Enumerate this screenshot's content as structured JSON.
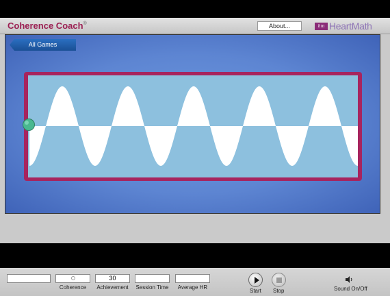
{
  "header": {
    "title": "Coherence Coach",
    "title_mark": "®",
    "about_label": "About...",
    "logo_text": "HeartMath",
    "logo_mark": "hm"
  },
  "game": {
    "all_games_label": "All Games",
    "wave_cycles": 5,
    "colors": {
      "frame": "#a7245e",
      "field": "#8dc0de",
      "wave": "#ffffff",
      "ball": "#49b88f"
    }
  },
  "controls": {
    "field1_value": "",
    "coherence_label": "Coherence",
    "achievement_value": "30",
    "achievement_label": "Achievement",
    "session_time_value": "",
    "session_time_label": "Session Time",
    "average_hr_value": "",
    "average_hr_label": "Average HR",
    "start_label": "Start",
    "stop_label": "Stop",
    "sound_label": "Sound On/Off"
  },
  "icons": [
    "play-icon",
    "stop-icon",
    "speaker-icon",
    "coherence-indicator-icon",
    "heartmath-logo-icon"
  ]
}
